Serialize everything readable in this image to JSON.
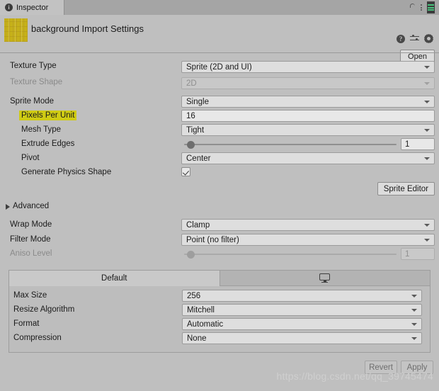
{
  "window": {
    "tab_label": "Inspector",
    "tab_icon": "info-icon",
    "lock_icon": "lock-open-icon",
    "menu_icon": "kebab-menu-icon"
  },
  "header": {
    "title": "background Import Settings",
    "thumbnail": "texture-thumbnail",
    "thumbnail_color": "#c6b119",
    "help_icon": "help-icon",
    "preset_icon": "preset-icon",
    "settings_icon": "gear-icon",
    "open_label": "Open"
  },
  "settings": {
    "texture_type": {
      "label": "Texture Type",
      "value": "Sprite (2D and UI)",
      "disabled": false
    },
    "texture_shape": {
      "label": "Texture Shape",
      "value": "2D",
      "disabled": true
    },
    "sprite_mode": {
      "label": "Sprite Mode",
      "value": "Single",
      "disabled": false
    },
    "pixels_per_unit": {
      "label": "Pixels Per Unit",
      "value": "16",
      "highlighted": true
    },
    "mesh_type": {
      "label": "Mesh Type",
      "value": "Tight"
    },
    "extrude_edges": {
      "label": "Extrude Edges",
      "value": "1"
    },
    "pivot": {
      "label": "Pivot",
      "value": "Center"
    },
    "generate_physics_shape": {
      "label": "Generate Physics Shape",
      "checked": true
    },
    "sprite_editor_label": "Sprite Editor"
  },
  "advanced": {
    "label": "Advanced",
    "expanded": false
  },
  "texture_options": {
    "wrap_mode": {
      "label": "Wrap Mode",
      "value": "Clamp",
      "disabled": false
    },
    "filter_mode": {
      "label": "Filter Mode",
      "value": "Point (no filter)",
      "disabled": false
    },
    "aniso_level": {
      "label": "Aniso Level",
      "value": "1",
      "disabled": true
    }
  },
  "platform": {
    "tabs": [
      {
        "label": "Default",
        "icon": "",
        "active": true
      },
      {
        "label": "",
        "icon": "monitor-icon",
        "active": false
      }
    ],
    "rows": [
      {
        "label": "Max Size",
        "value": "256"
      },
      {
        "label": "Resize Algorithm",
        "value": "Mitchell"
      },
      {
        "label": "Format",
        "value": "Automatic"
      },
      {
        "label": "Compression",
        "value": "None"
      }
    ]
  },
  "footer": {
    "revert_label": "Revert",
    "apply_label": "Apply",
    "watermark": "https://blog.csdn.net/qq_39745474"
  }
}
